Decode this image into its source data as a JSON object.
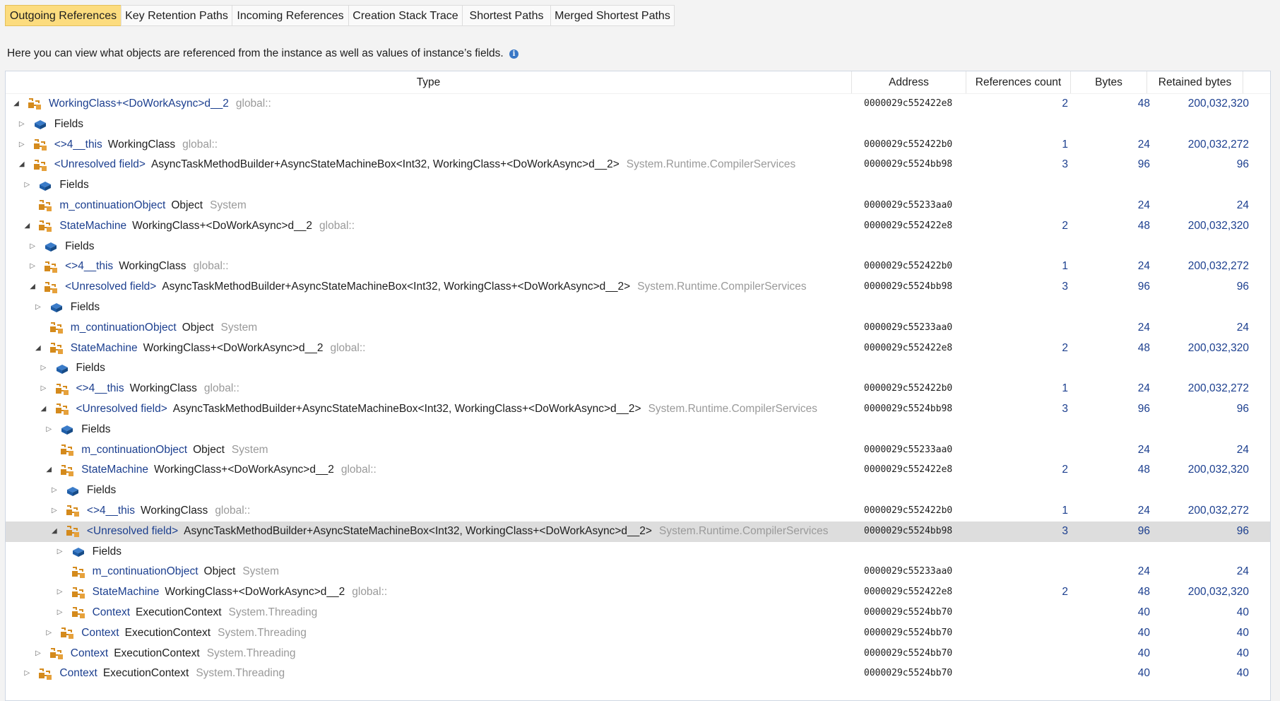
{
  "tabs": [
    "Outgoing References",
    "Key Retention Paths",
    "Incoming References",
    "Creation Stack Trace",
    "Shortest Paths",
    "Merged Shortest Paths"
  ],
  "description": "Here you can view what objects are referenced from the instance as well as values of instance’s fields.",
  "columns": {
    "type": "Type",
    "address": "Address",
    "refs": "References count",
    "bytes": "Bytes",
    "retained": "Retained bytes"
  },
  "colors": {
    "active_tab": "#fcdc7e",
    "link": "#1c3f8f",
    "namespace": "#9a9a9a",
    "selected_row": "#dddddd",
    "icon_orange": "#d48a1c",
    "icon_blue": "#1f5ea8"
  },
  "rows": [
    {
      "level": 0,
      "toggle": "expanded",
      "icon": "object-icon",
      "field": "",
      "type": "WorkingClass+<DoWorkAsync>d__2",
      "ns": "global::",
      "address": "0000029c552422e8",
      "refs": "2",
      "bytes": "48",
      "retained": "200,032,320"
    },
    {
      "level": 1,
      "toggle": "collapsed",
      "icon": "fields-icon",
      "label": "Fields"
    },
    {
      "level": 1,
      "toggle": "collapsed",
      "icon": "object-icon",
      "field": "<>4__this",
      "type": "WorkingClass",
      "ns": "global::",
      "address": "0000029c552422b0",
      "refs": "1",
      "bytes": "24",
      "retained": "200,032,272"
    },
    {
      "level": 1,
      "toggle": "expanded",
      "icon": "object-icon",
      "field": "<Unresolved field>",
      "type": "AsyncTaskMethodBuilder+AsyncStateMachineBox<Int32, WorkingClass+<DoWorkAsync>d__2>",
      "ns": "System.Runtime.CompilerServices",
      "address": "0000029c5524bb98",
      "refs": "3",
      "bytes": "96",
      "retained": "96"
    },
    {
      "level": 2,
      "toggle": "collapsed",
      "icon": "fields-icon",
      "label": "Fields"
    },
    {
      "level": 2,
      "toggle": "none",
      "icon": "object-icon",
      "field": "m_continuationObject",
      "type": "Object",
      "ns": "System",
      "address": "0000029c55233aa0",
      "refs": "",
      "bytes": "24",
      "retained": "24"
    },
    {
      "level": 2,
      "toggle": "expanded",
      "icon": "object-icon",
      "field": "StateMachine",
      "type": "WorkingClass+<DoWorkAsync>d__2",
      "ns": "global::",
      "address": "0000029c552422e8",
      "refs": "2",
      "bytes": "48",
      "retained": "200,032,320"
    },
    {
      "level": 3,
      "toggle": "collapsed",
      "icon": "fields-icon",
      "label": "Fields"
    },
    {
      "level": 3,
      "toggle": "collapsed",
      "icon": "object-icon",
      "field": "<>4__this",
      "type": "WorkingClass",
      "ns": "global::",
      "address": "0000029c552422b0",
      "refs": "1",
      "bytes": "24",
      "retained": "200,032,272"
    },
    {
      "level": 3,
      "toggle": "expanded",
      "icon": "object-icon",
      "field": "<Unresolved field>",
      "type": "AsyncTaskMethodBuilder+AsyncStateMachineBox<Int32, WorkingClass+<DoWorkAsync>d__2>",
      "ns": "System.Runtime.CompilerServices",
      "address": "0000029c5524bb98",
      "refs": "3",
      "bytes": "96",
      "retained": "96"
    },
    {
      "level": 4,
      "toggle": "collapsed",
      "icon": "fields-icon",
      "label": "Fields"
    },
    {
      "level": 4,
      "toggle": "none",
      "icon": "object-icon",
      "field": "m_continuationObject",
      "type": "Object",
      "ns": "System",
      "address": "0000029c55233aa0",
      "refs": "",
      "bytes": "24",
      "retained": "24"
    },
    {
      "level": 4,
      "toggle": "expanded",
      "icon": "object-icon",
      "field": "StateMachine",
      "type": "WorkingClass+<DoWorkAsync>d__2",
      "ns": "global::",
      "address": "0000029c552422e8",
      "refs": "2",
      "bytes": "48",
      "retained": "200,032,320"
    },
    {
      "level": 5,
      "toggle": "collapsed",
      "icon": "fields-icon",
      "label": "Fields"
    },
    {
      "level": 5,
      "toggle": "collapsed",
      "icon": "object-icon",
      "field": "<>4__this",
      "type": "WorkingClass",
      "ns": "global::",
      "address": "0000029c552422b0",
      "refs": "1",
      "bytes": "24",
      "retained": "200,032,272"
    },
    {
      "level": 5,
      "toggle": "expanded",
      "icon": "object-icon",
      "field": "<Unresolved field>",
      "type": "AsyncTaskMethodBuilder+AsyncStateMachineBox<Int32, WorkingClass+<DoWorkAsync>d__2>",
      "ns": "System.Runtime.CompilerServices",
      "address": "0000029c5524bb98",
      "refs": "3",
      "bytes": "96",
      "retained": "96"
    },
    {
      "level": 6,
      "toggle": "collapsed",
      "icon": "fields-icon",
      "label": "Fields"
    },
    {
      "level": 6,
      "toggle": "none",
      "icon": "object-icon",
      "field": "m_continuationObject",
      "type": "Object",
      "ns": "System",
      "address": "0000029c55233aa0",
      "refs": "",
      "bytes": "24",
      "retained": "24"
    },
    {
      "level": 6,
      "toggle": "expanded",
      "icon": "object-icon",
      "field": "StateMachine",
      "type": "WorkingClass+<DoWorkAsync>d__2",
      "ns": "global::",
      "address": "0000029c552422e8",
      "refs": "2",
      "bytes": "48",
      "retained": "200,032,320"
    },
    {
      "level": 7,
      "toggle": "collapsed",
      "icon": "fields-icon",
      "label": "Fields"
    },
    {
      "level": 7,
      "toggle": "collapsed",
      "icon": "object-icon",
      "field": "<>4__this",
      "type": "WorkingClass",
      "ns": "global::",
      "address": "0000029c552422b0",
      "refs": "1",
      "bytes": "24",
      "retained": "200,032,272"
    },
    {
      "level": 7,
      "toggle": "expanded",
      "icon": "object-icon",
      "field": "<Unresolved field>",
      "type": "AsyncTaskMethodBuilder+AsyncStateMachineBox<Int32, WorkingClass+<DoWorkAsync>d__2>",
      "ns": "System.Runtime.CompilerServices",
      "address": "0000029c5524bb98",
      "refs": "3",
      "bytes": "96",
      "retained": "96",
      "selected": true
    },
    {
      "level": 8,
      "toggle": "collapsed",
      "icon": "fields-icon",
      "label": "Fields"
    },
    {
      "level": 8,
      "toggle": "none",
      "icon": "object-icon",
      "field": "m_continuationObject",
      "type": "Object",
      "ns": "System",
      "address": "0000029c55233aa0",
      "refs": "",
      "bytes": "24",
      "retained": "24"
    },
    {
      "level": 8,
      "toggle": "collapsed",
      "icon": "object-icon",
      "field": "StateMachine",
      "type": "WorkingClass+<DoWorkAsync>d__2",
      "ns": "global::",
      "address": "0000029c552422e8",
      "refs": "2",
      "bytes": "48",
      "retained": "200,032,320"
    },
    {
      "level": 8,
      "toggle": "collapsed",
      "icon": "object-icon",
      "field": "Context",
      "type": "ExecutionContext",
      "ns": "System.Threading",
      "address": "0000029c5524bb70",
      "refs": "",
      "bytes": "40",
      "retained": "40"
    },
    {
      "level": 6,
      "toggle": "collapsed",
      "icon": "object-icon",
      "field": "Context",
      "type": "ExecutionContext",
      "ns": "System.Threading",
      "address": "0000029c5524bb70",
      "refs": "",
      "bytes": "40",
      "retained": "40"
    },
    {
      "level": 4,
      "toggle": "collapsed",
      "icon": "object-icon",
      "field": "Context",
      "type": "ExecutionContext",
      "ns": "System.Threading",
      "address": "0000029c5524bb70",
      "refs": "",
      "bytes": "40",
      "retained": "40"
    },
    {
      "level": 2,
      "toggle": "collapsed",
      "icon": "object-icon",
      "field": "Context",
      "type": "ExecutionContext",
      "ns": "System.Threading",
      "address": "0000029c5524bb70",
      "refs": "",
      "bytes": "40",
      "retained": "40"
    }
  ]
}
